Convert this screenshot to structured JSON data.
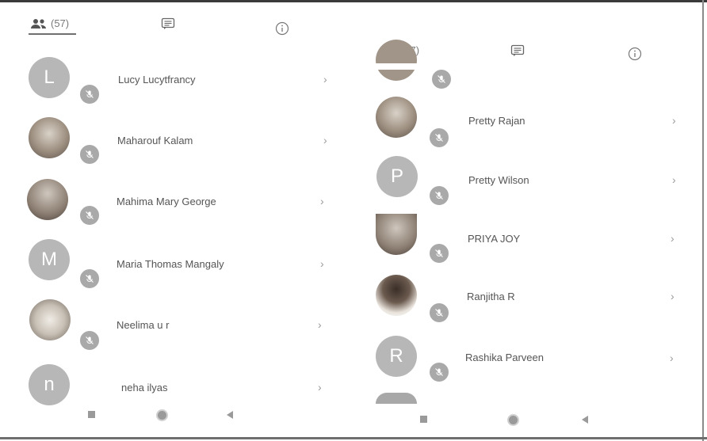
{
  "left_panel": {
    "tabs": {
      "participants_count": "(57)",
      "chat_icon": "chat-icon",
      "info_icon": "info-icon"
    },
    "participants": [
      {
        "initial": "L",
        "name": "Lucy Lucytfrancy",
        "avatar": "letter"
      },
      {
        "initial": "",
        "name": "Maharouf Kalam",
        "avatar": "photo"
      },
      {
        "initial": "",
        "name": "Mahima Mary George",
        "avatar": "photo"
      },
      {
        "initial": "M",
        "name": "Maria Thomas Mangaly",
        "avatar": "letter"
      },
      {
        "initial": "",
        "name": "Neelima u r",
        "avatar": "photo"
      },
      {
        "initial": "n",
        "name": "neha ilyas",
        "avatar": "letter"
      }
    ]
  },
  "right_panel": {
    "tabs": {
      "participants_count": "(57)",
      "chat_icon": "chat-icon",
      "info_icon": "info-icon"
    },
    "participants": [
      {
        "initial": "",
        "name": "Pretty Rajan",
        "avatar": "photo"
      },
      {
        "initial": "P",
        "name": "Pretty Wilson",
        "avatar": "letter"
      },
      {
        "initial": "",
        "name": "PRIYA JOY",
        "avatar": "photo"
      },
      {
        "initial": "",
        "name": "Ranjitha R",
        "avatar": "photo"
      },
      {
        "initial": "R",
        "name": "Rashika Parveen",
        "avatar": "letter"
      }
    ]
  },
  "icons": {
    "participants": "people-icon",
    "mic_muted": "mic-off-icon",
    "chevron": "chevron-right-icon",
    "nav_recent": "square-icon",
    "nav_home": "circle-icon",
    "nav_back": "back-triangle-icon"
  }
}
